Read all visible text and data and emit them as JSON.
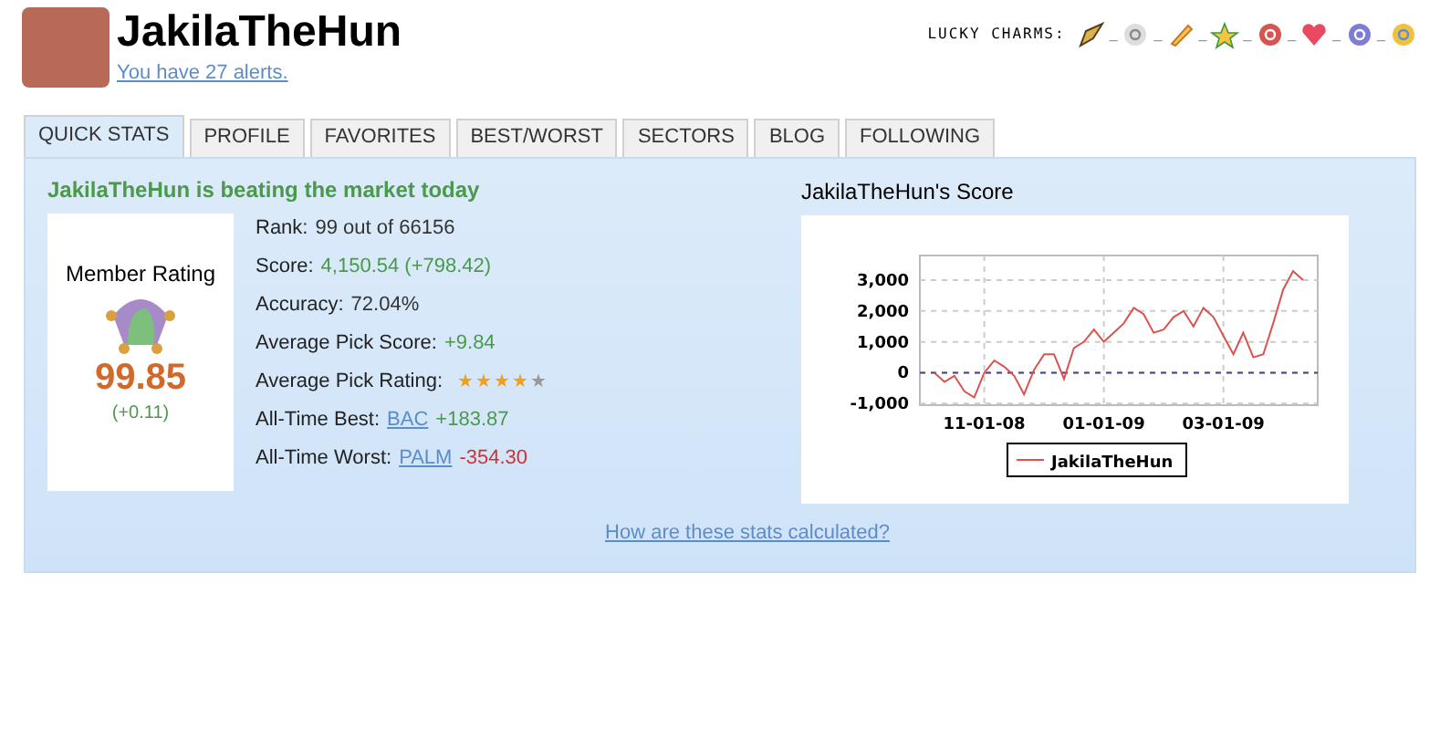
{
  "profile": {
    "username": "JakilaTheHun",
    "alerts_link": "You have 27 alerts."
  },
  "lucky_charms": {
    "label": "LUCKY CHARMS:",
    "separator": "_"
  },
  "tabs": [
    {
      "label": "QUICK STATS",
      "selected": true
    },
    {
      "label": "PROFILE",
      "selected": false
    },
    {
      "label": "FAVORITES",
      "selected": false
    },
    {
      "label": "BEST/WORST",
      "selected": false
    },
    {
      "label": "SECTORS",
      "selected": false
    },
    {
      "label": "BLOG",
      "selected": false
    },
    {
      "label": "FOLLOWING",
      "selected": false
    }
  ],
  "headline": "JakilaTheHun is beating the market today",
  "rating": {
    "title": "Member Rating",
    "value": "99.85",
    "change": "(+0.11)"
  },
  "stats": [
    {
      "kind": "plain",
      "label": "Rank:",
      "value": "99 out of 66156"
    },
    {
      "kind": "positive",
      "label": "Score:",
      "value": "4,150.54 (+798.42)"
    },
    {
      "kind": "plain",
      "label": "Accuracy:",
      "value": "72.04%"
    },
    {
      "kind": "positive",
      "label": "Average Pick Score:",
      "value": "+9.84"
    },
    {
      "kind": "stars",
      "label": "Average Pick Rating:",
      "stars": 4
    },
    {
      "kind": "link_positive",
      "label": "All-Time Best:",
      "link": "BAC",
      "value": "+183.87"
    },
    {
      "kind": "link_negative",
      "label": "All-Time Worst:",
      "link": "PALM",
      "value": "-354.30"
    }
  ],
  "score_chart": {
    "title": "JakilaTheHun's Score",
    "chart_data": {
      "type": "line",
      "categories": [
        null,
        null,
        null,
        null,
        null,
        "11-01-08",
        null,
        null,
        null,
        null,
        null,
        null,
        null,
        null,
        null,
        null,
        null,
        "01-01-09",
        null,
        null,
        null,
        null,
        null,
        null,
        null,
        null,
        null,
        null,
        null,
        "03-01-09",
        null,
        null,
        null,
        null,
        null,
        null,
        null,
        null
      ],
      "series": [
        {
          "name": "JakilaTheHun",
          "color": "#d9534f",
          "values": [
            0,
            -300,
            -100,
            -600,
            -800,
            0,
            400,
            200,
            -100,
            -700,
            100,
            600,
            600,
            -200,
            800,
            1000,
            1400,
            1000,
            1300,
            1600,
            2100,
            1900,
            1300,
            1400,
            1800,
            2000,
            1500,
            2100,
            1800,
            1200,
            600,
            1300,
            500,
            600,
            1600,
            2700,
            3300,
            3000
          ]
        }
      ],
      "ylim": [
        -1050,
        3800
      ],
      "grid": true,
      "ref_lines": [
        {
          "axis": "y",
          "value": 0,
          "color": "#444488"
        }
      ],
      "yticks": [
        {
          "value": 3000,
          "label": "3,000"
        },
        {
          "value": 2000,
          "label": "2,000"
        },
        {
          "value": 1000,
          "label": "1,000"
        },
        {
          "value": 0,
          "label": "0"
        },
        {
          "value": -1000,
          "label": "-1,000"
        }
      ]
    }
  },
  "footer_link": "How are these stats calculated?"
}
